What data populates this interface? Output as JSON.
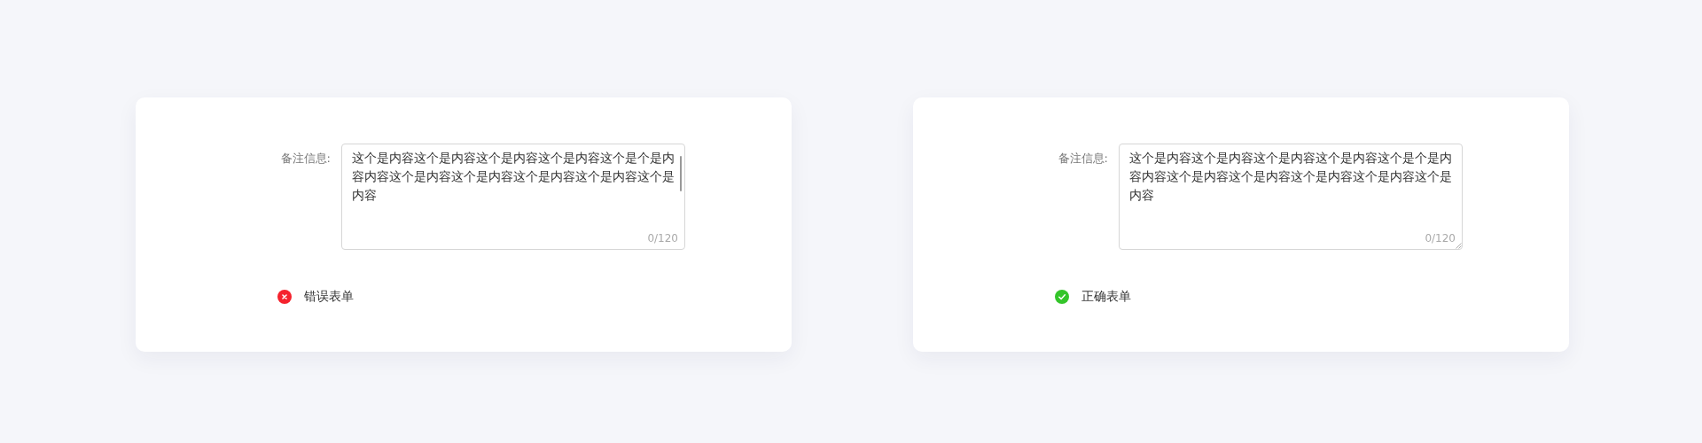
{
  "cards": [
    {
      "field": {
        "label": "备注信息:",
        "value": "这个是内容这个是内容这个是内容这个是内容这个是个是内容内容这个是内容这个是内容这个是内容这个是内容这个是内容",
        "counter": "0/120",
        "scrolled": true,
        "resizable": false
      },
      "status": {
        "kind": "error",
        "text": "错误表单"
      }
    },
    {
      "field": {
        "label": "备注信息:",
        "value": "这个是内容这个是内容这个是内容这个是内容这个是个是内容内容这个是内容这个是内容这个是内容这个是内容这个是内容",
        "counter": "0/120",
        "scrolled": false,
        "resizable": true
      },
      "status": {
        "kind": "success",
        "text": "正确表单"
      }
    }
  ]
}
